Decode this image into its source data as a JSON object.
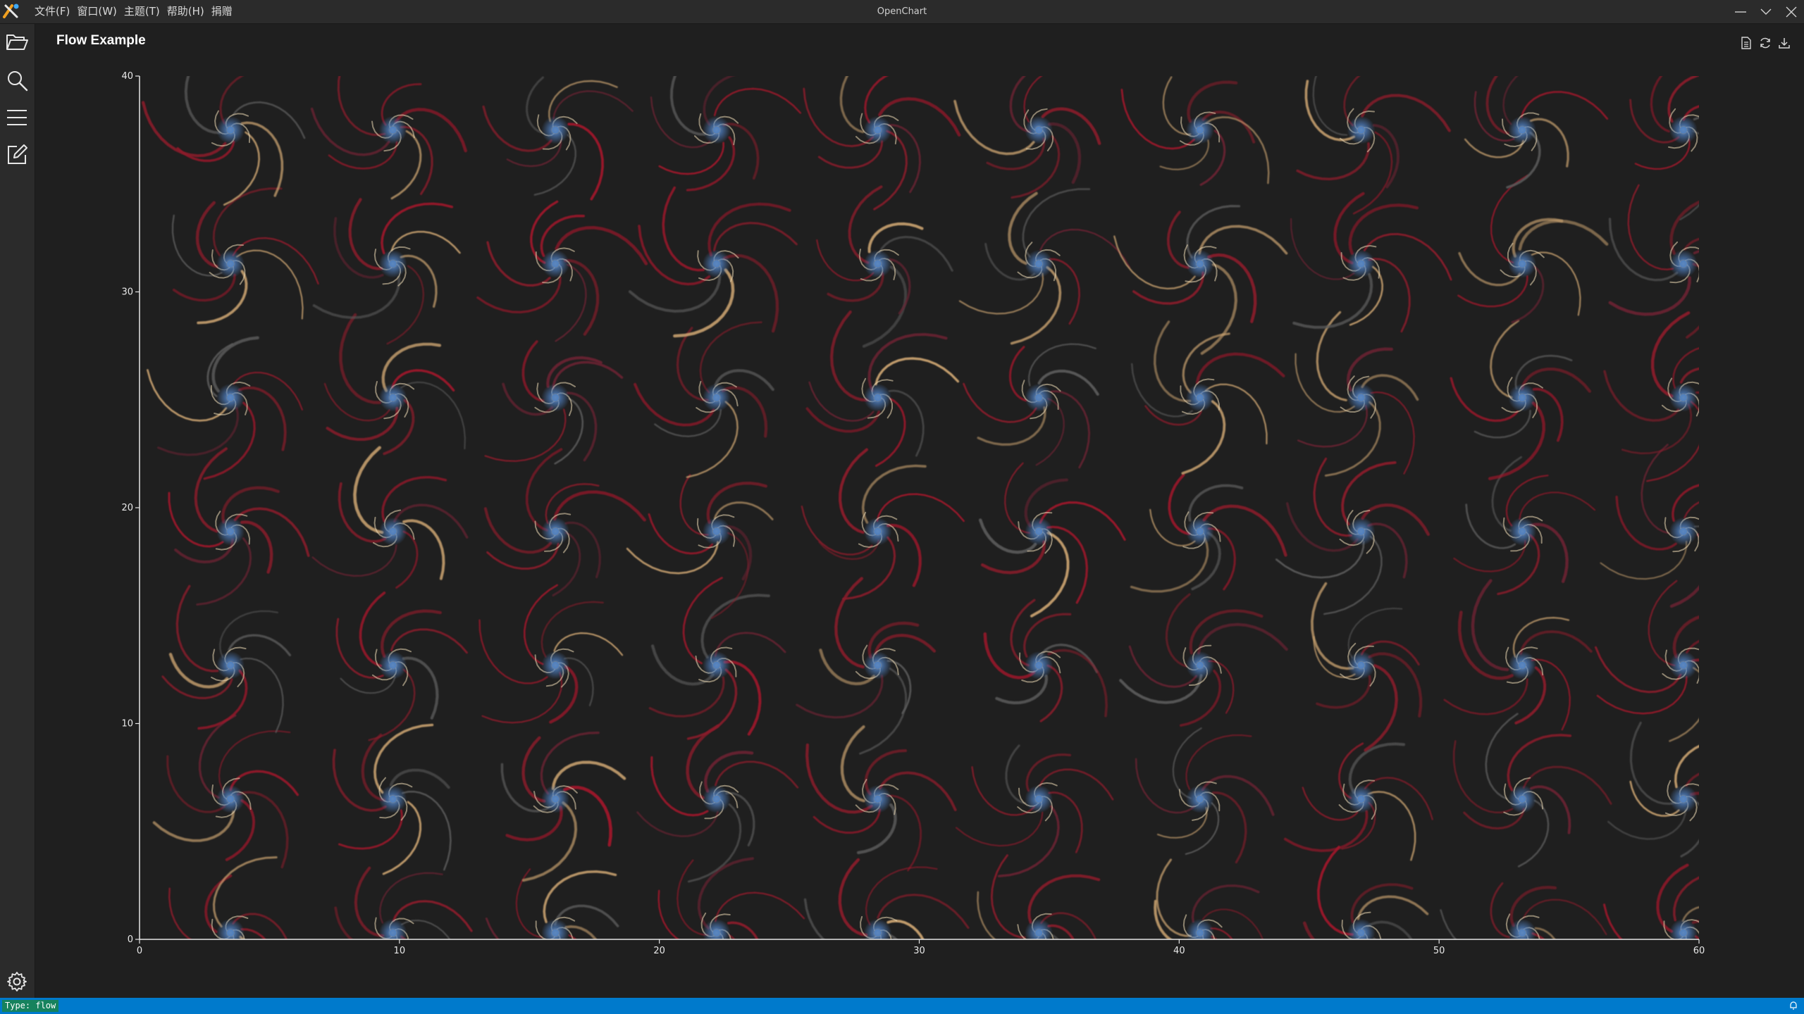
{
  "window": {
    "title": "OpenChart",
    "menu": [
      "文件(F)",
      "窗口(W)",
      "主题(T)",
      "帮助(H)",
      "捐赠"
    ]
  },
  "sidebar": {
    "items": [
      {
        "name": "open-folder",
        "icon": "folder-open-icon"
      },
      {
        "name": "search",
        "icon": "search-icon"
      },
      {
        "name": "list",
        "icon": "menu-icon"
      },
      {
        "name": "edit",
        "icon": "edit-icon"
      }
    ],
    "bottom": {
      "name": "settings",
      "icon": "gear-icon"
    }
  },
  "chart_header": {
    "title": "Flow Example",
    "tools": [
      "document-icon",
      "refresh-icon",
      "download-icon"
    ]
  },
  "chart_data": {
    "type": "flow",
    "title": "Flow Example",
    "xlim": [
      0,
      60
    ],
    "ylim": [
      0,
      40
    ],
    "x_ticks": [
      0,
      10,
      20,
      30,
      40,
      50,
      60
    ],
    "y_ticks": [
      0,
      10,
      20,
      30,
      40
    ],
    "vortex_centers": {
      "x": [
        3.5,
        9.75,
        16,
        22.2,
        28.4,
        34.6,
        40.8,
        47,
        53.2,
        59.4
      ],
      "y": [
        0.3,
        6.5,
        12.7,
        18.9,
        25.1,
        31.3,
        37.5
      ]
    },
    "colors": {
      "background": "#1f1f1f",
      "streamline_primary": "#8b1a2c",
      "streamline_secondary": "#5a5a5a",
      "vortex_core_bright": "#e8d6b0",
      "vortex_core_blue": "#4f7fc0"
    }
  },
  "status": {
    "type_label": "Type: flow"
  },
  "theme": {
    "accent": "#007acc",
    "badge": "#16825d"
  }
}
